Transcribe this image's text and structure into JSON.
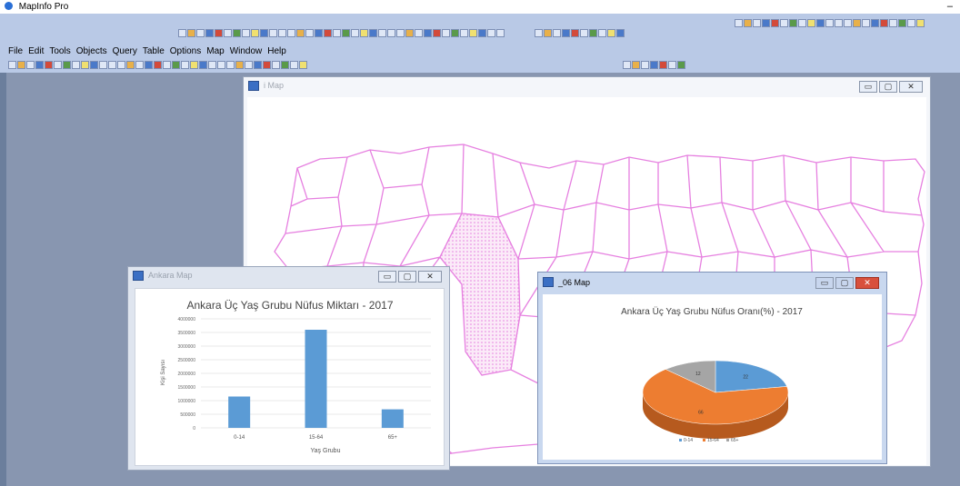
{
  "app": {
    "title": "MapInfo Pro",
    "minimize": "–"
  },
  "menu": [
    "File",
    "Edit",
    "Tools",
    "Objects",
    "Query",
    "Table",
    "Options",
    "Map",
    "Window",
    "Help"
  ],
  "window_buttons": {
    "minimize": "▭",
    "maximize": "▢",
    "close": "✕"
  },
  "windows": {
    "main_map": {
      "title": "i Map"
    },
    "ankara_map": {
      "title": "Ankara Map"
    },
    "pie_map": {
      "title": "_06 Map"
    }
  },
  "colors": {
    "bar": "#5b9bd5",
    "region_outline": "#e680e0",
    "pie_0_14": "#5b9bd5",
    "pie_15_64": "#ed7d31",
    "pie_65": "#a5a5a5"
  },
  "chart_data": [
    {
      "type": "bar",
      "title": "Ankara Üç Yaş Grubu Nüfus Miktarı - 2017",
      "xlabel": "Yaş Grubu",
      "ylabel": "Kişi Sayısı",
      "categories": [
        "0-14",
        "15-64",
        "65+"
      ],
      "values": [
        1150000,
        3600000,
        680000
      ],
      "ylim": [
        0,
        4000000
      ],
      "yticks": [
        "4000000",
        "3500000",
        "3000000",
        "2500000",
        "2000000",
        "1500000",
        "1000000",
        "500000",
        "0"
      ],
      "grid": true
    },
    {
      "type": "pie",
      "title": "Ankara Üç Yaş Grubu Nüfus Oranı(%) - 2017",
      "categories": [
        "0-14",
        "15-64",
        "65+"
      ],
      "values": [
        22,
        66,
        12
      ],
      "labels": [
        "22",
        "66",
        "12"
      ],
      "legend_position": "bottom"
    }
  ]
}
